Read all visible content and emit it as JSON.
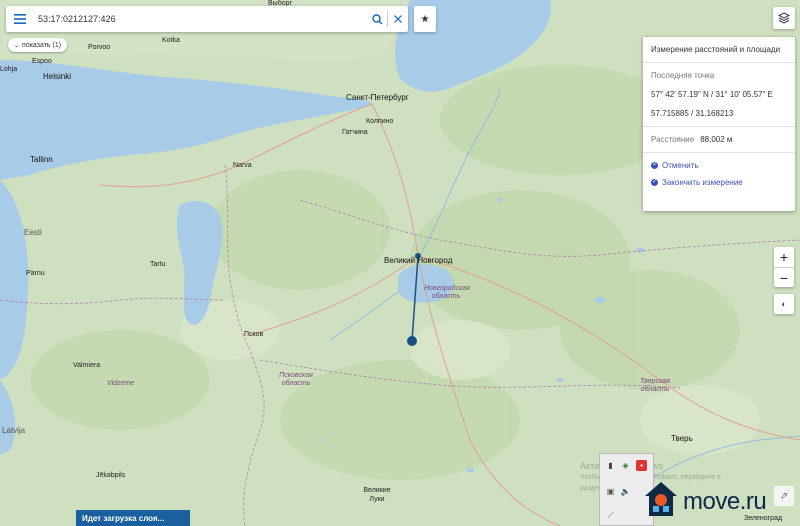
{
  "toolbar": {
    "menu_icon": "hamburger-icon",
    "search_value": "53:17:0212127:426",
    "search_icon": "search-icon",
    "clear_icon": "close-icon",
    "favorite_icon": "star-icon",
    "show_chip_label": "показать (1)"
  },
  "layers_icon": "layers-icon",
  "measurement_panel": {
    "title": "Измерение расстояний и площади",
    "last_point_label": "Последняя точка",
    "coords_dms": "57° 42' 57.19\" N / 31° 10' 05.57\" E",
    "coords_decimal": "57.715885 / 31.168213",
    "distance_label": "Расстояние",
    "distance_value": "88,002 м",
    "cancel_label": "Отменить",
    "finish_label": "Закончить измерение"
  },
  "zoom": {
    "in": "+",
    "out": "−"
  },
  "loading_text": "Идет загрузка слоя...",
  "activation_watermark": {
    "line1": "Активация Windows",
    "line2": "Чтобы активировать Windows, перейдите в раздел «Параметры»."
  },
  "brand": {
    "name": "move.ru"
  },
  "map_labels": {
    "vyborg": "Выборг",
    "kotka": "Kotka",
    "porvoo": "Porvoo",
    "lohja": "Lohja",
    "espoo": "Espoo",
    "helsinki": "Helsinki",
    "spb": "Санкт-Петербург",
    "kolpino": "Колпино",
    "gatchina": "Гатчина",
    "tallinn": "Tallinn",
    "narva": "Narva",
    "eesti": "Eesti",
    "tartu": "Tartu",
    "parnu": "Pärnu",
    "veliky_novgorod": "Великий Новгород",
    "novgorod_region": "Новгородская область",
    "pskov": "Псков",
    "pskov_region": "Псковская область",
    "valmiera": "Valmiera",
    "vidzeme": "Vidzeme",
    "tver_region": "Тверская область",
    "tver": "Тверь",
    "latvija": "Latvija",
    "jekabpils": "Jēkabpils",
    "velikie_luki": "Великие Луки",
    "zelenograd": "Зеленоград"
  },
  "measurement_line": {
    "start": {
      "lat": 58.52,
      "lon": 31.27
    },
    "end": {
      "lat": 57.715885,
      "lon": 31.168213
    }
  },
  "colors": {
    "accent": "#1565c0",
    "line": "#1a4f86",
    "water": "#a8cbe8",
    "land": "#cfe0c0",
    "action": "#3d4fbf"
  }
}
